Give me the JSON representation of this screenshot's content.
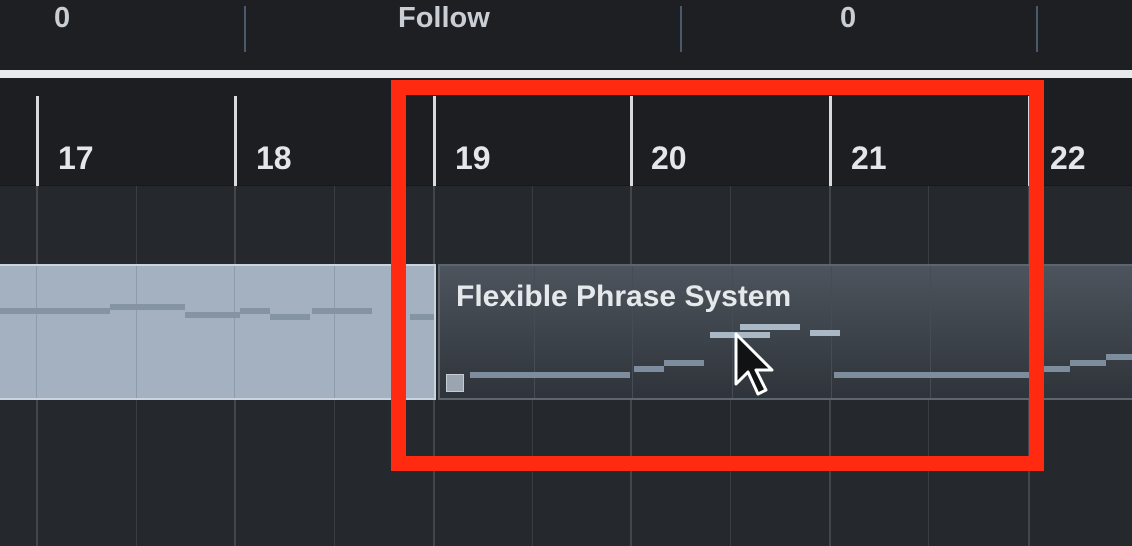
{
  "info_bar": {
    "left_value": "0",
    "mode_label": "Follow",
    "right_value": "0"
  },
  "ruler": {
    "bars": [
      "17",
      "18",
      "19",
      "20",
      "21",
      "22"
    ]
  },
  "part": {
    "title": "Flexible Phrase System"
  },
  "colors": {
    "highlight": "#ff2a10",
    "background": "#23262a",
    "selected_part": "#a3b1c0"
  },
  "icons": {
    "cursor": "arrow-pointer-icon",
    "resize_handle": "square-handle-icon"
  }
}
